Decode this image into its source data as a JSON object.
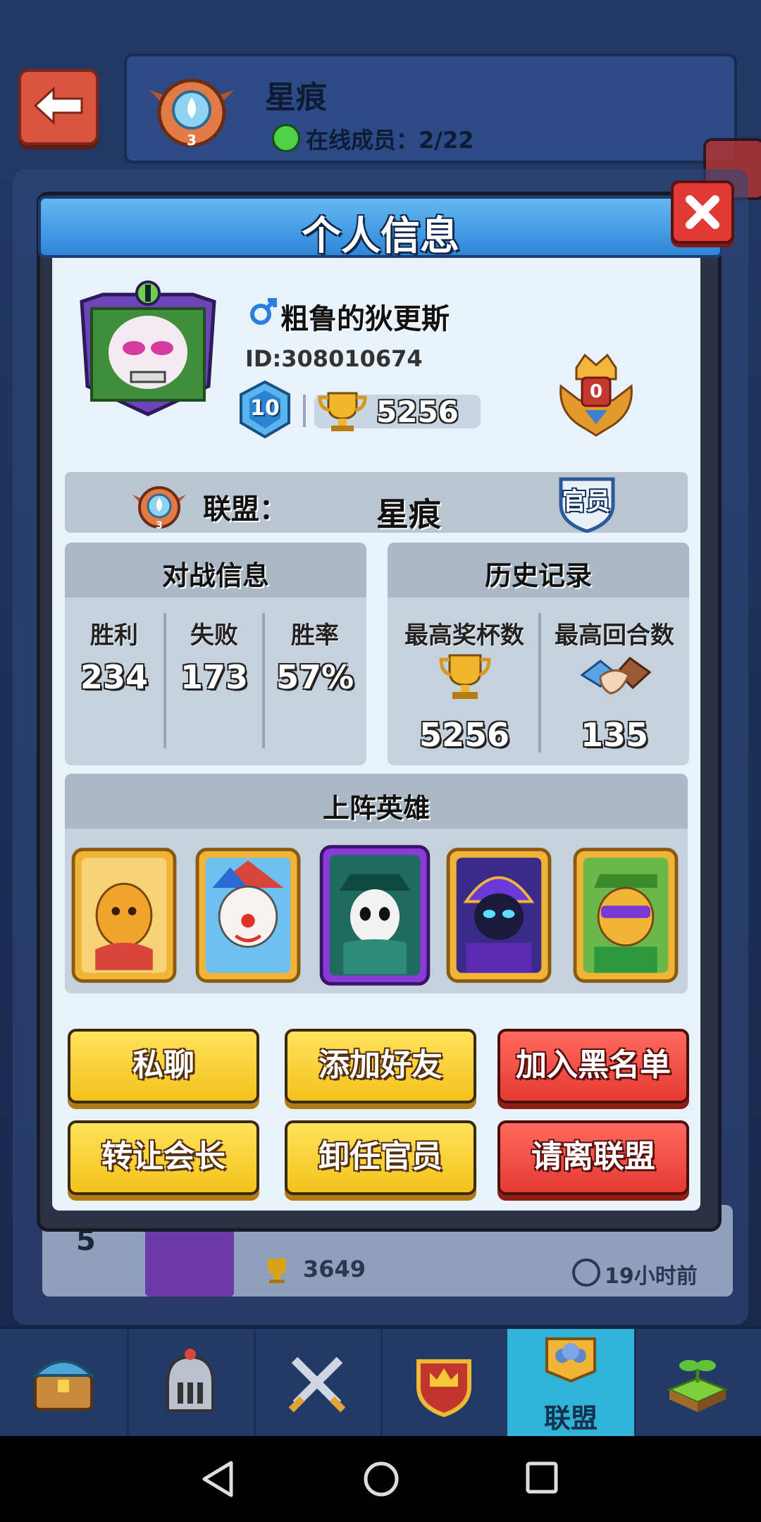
{
  "clan_header": {
    "name": "星痕",
    "level_badge": "3",
    "online_label": "在线成员：2/22"
  },
  "dialog": {
    "title": "个人信息",
    "player": {
      "name": "粗鲁的狄更斯",
      "id": "ID:308010674",
      "level": "10",
      "trophies": "5256",
      "rank_badge": "0"
    },
    "clan_row": {
      "label": "联盟：",
      "value": "星痕",
      "clan_level": "3",
      "role_badge": "官员"
    },
    "battle_info": {
      "title": "对战信息",
      "wins_label": "胜利",
      "wins": "234",
      "losses_label": "失败",
      "losses": "173",
      "winrate_label": "胜率",
      "winrate": "57%"
    },
    "history": {
      "title": "历史记录",
      "max_trophies_label": "最高奖杯数",
      "max_trophies": "5256",
      "max_rounds_label": "最高回合数",
      "max_rounds": "135"
    },
    "heroes": {
      "title": "上阵英雄",
      "cards": [
        "hero-golden-warrior",
        "hero-clown",
        "hero-masked-detective",
        "hero-dark-wizard",
        "hero-green-riddler"
      ]
    },
    "buttons": {
      "private_chat": "私聊",
      "add_friend": "添加好友",
      "blacklist": "加入黑名单",
      "transfer_leader": "转让会长",
      "resign_officer": "卸任官员",
      "kick": "请离联盟"
    }
  },
  "background_list": {
    "rank": "5",
    "trophies": "3649",
    "last_seen": "19小时前"
  },
  "bottom_nav": {
    "items": [
      "chest-icon",
      "helmet-icon",
      "crossed-swords-icon",
      "crown-shield-icon",
      "clan-icon",
      "sprout-icon"
    ],
    "active_label": "联盟"
  },
  "colors": {
    "accent_blue": "#2f86d8",
    "button_yellow": "#f3c21b",
    "button_red": "#e43a32",
    "online_green": "#4fd24a"
  }
}
